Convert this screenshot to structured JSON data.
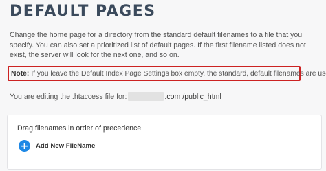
{
  "page": {
    "title": "DEFAULT PAGES",
    "description": "Change the home page for a directory from the standard default filenames to a file that you specify. You can also set a prioritized list of default pages. If the first filename listed does not exist, the server will look for the next one, and so on."
  },
  "note": {
    "label": "Note:",
    "text": "If you leave the Default Index Page Settings box empty, the standard, default filenames are used."
  },
  "editing": {
    "prefix": "You are editing the .htaccess file for:",
    "domain_suffix": ".com /public_html"
  },
  "panel": {
    "heading": "Drag filenames in order of precedence",
    "add_button_label": "Add New FileName",
    "add_icon": "plus-icon"
  },
  "colors": {
    "accent": "#1e88e5",
    "note_border": "#cc2222",
    "title": "#3b4a5c"
  }
}
